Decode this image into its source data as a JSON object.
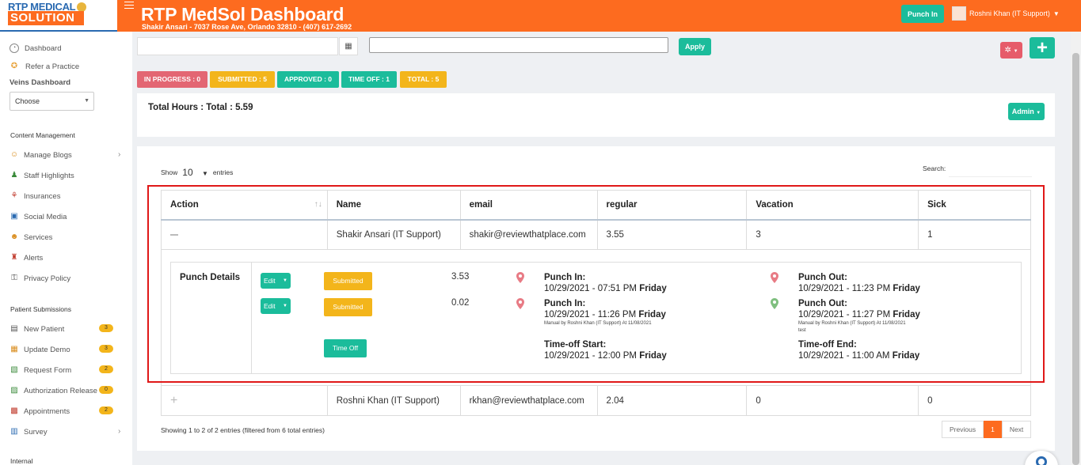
{
  "header": {
    "logo_top": "RTP MEDICAL",
    "logo_bottom": "SOLUTION",
    "title": "RTP MedSol Dashboard",
    "subtitle": "Shakir Ansari - 7037 Rose Ave, Orlando 32810 - (407) 617-2692",
    "punch_in_label": "Punch In",
    "user_name": "Roshni Khan (IT Support)"
  },
  "sidebar": {
    "top_items": [
      {
        "label": "Dashboard",
        "icon": "gauge-icon"
      },
      {
        "label": "Refer a Practice",
        "icon": "refer-icon"
      }
    ],
    "veins_label": "Veins Dashboard",
    "choose_value": "Choose",
    "content_heading": "Content Management",
    "content_items": [
      {
        "label": "Manage Blogs",
        "icon": "blog-icon"
      },
      {
        "label": "Staff Highlights",
        "icon": "staff-icon"
      },
      {
        "label": "Insurances",
        "icon": "insurance-icon"
      },
      {
        "label": "Social Media",
        "icon": "social-icon"
      },
      {
        "label": "Services",
        "icon": "services-icon"
      },
      {
        "label": "Alerts",
        "icon": "alert-icon"
      },
      {
        "label": "Privacy Policy",
        "icon": "privacy-icon"
      }
    ],
    "patient_heading": "Patient Submissions",
    "patient_items": [
      {
        "label": "New Patient",
        "badge": "3",
        "icon": "new-patient-icon"
      },
      {
        "label": "Update Demo",
        "badge": "3",
        "icon": "update-demo-icon"
      },
      {
        "label": "Request Form",
        "badge": "2",
        "icon": "request-form-icon"
      },
      {
        "label": "Authorization Release",
        "badge": "0",
        "icon": "authorization-icon"
      },
      {
        "label": "Appointments",
        "badge": "2",
        "icon": "appointments-icon"
      },
      {
        "label": "Survey",
        "icon": "survey-icon"
      }
    ],
    "internal_heading": "Internal"
  },
  "filters": {
    "apply_label": "Apply"
  },
  "status_pills": [
    {
      "label": "IN PROGRESS : 0",
      "color": "#e36673"
    },
    {
      "label": "SUBMITTED : 5",
      "color": "#f3b51b"
    },
    {
      "label": "APPROVED : 0",
      "color": "#1bbc9b"
    },
    {
      "label": "TIME OFF : 1",
      "color": "#1bbc9b"
    },
    {
      "label": "TOTAL : 5",
      "color": "#f3b51b"
    }
  ],
  "summary": {
    "total_hours": "Total Hours : Total : 5.59",
    "admin_label": "Admin"
  },
  "table": {
    "show_label": "Show",
    "show_value": "10",
    "entries_label": "entries",
    "search_label": "Search:",
    "columns": [
      "Action",
      "Name",
      "email",
      "regular",
      "Vacation",
      "Sick"
    ],
    "rows": [
      {
        "action": "−",
        "name": "Shakir Ansari (IT Support)",
        "email": "shakir@reviewthatplace.com",
        "regular": "3.55",
        "vacation": "3",
        "sick": "1"
      },
      {
        "action": "+",
        "name": "Roshni Khan (IT Support)",
        "email": "rkhan@reviewthatplace.com",
        "regular": "2.04",
        "vacation": "0",
        "sick": "0"
      }
    ],
    "detail": {
      "label": "Punch Details",
      "entries": [
        {
          "edit_label": "Edit",
          "status_label": "Submitted",
          "hours": "3.53",
          "in_label": "Punch In:",
          "in_date": "10/29/2021 - 07:51 PM",
          "in_day": "Friday",
          "in_note": "",
          "out_label": "Punch Out:",
          "out_date": "10/29/2021 - 11:23 PM",
          "out_day": "Friday",
          "out_note": "",
          "out_note2": ""
        },
        {
          "edit_label": "Edit",
          "status_label": "Submitted",
          "hours": "0.02",
          "in_label": "Punch In:",
          "in_date": "10/29/2021 - 11:26 PM",
          "in_day": "Friday",
          "in_note": "Manual by Roshni Khan (IT Support) At 11/08/2021",
          "out_label": "Punch Out:",
          "out_date": "10/29/2021 - 11:27 PM",
          "out_day": "Friday",
          "out_note": "Manual by Roshni Khan (IT Support) At 11/08/2021",
          "out_note2": "test"
        }
      ],
      "timeoff": {
        "button_label": "Time Off",
        "start_label": "Time-off Start:",
        "start_date": "10/29/2021 - 12:00 PM",
        "start_day": "Friday",
        "end_label": "Time-off End:",
        "end_date": "10/29/2021 - 11:00 AM",
        "end_day": "Friday"
      }
    },
    "showing_text": "Showing 1 to 2 of 2 entries (filtered from 6 total entries)",
    "pagination": {
      "previous": "Previous",
      "current": "1",
      "next": "Next"
    }
  },
  "colors": {
    "brand_orange": "#fd6b1f",
    "accent_green": "#1bbc9b",
    "badge_yellow": "#f3b51b",
    "danger_red": "#e65c6a",
    "highlight_red": "#e01818"
  }
}
